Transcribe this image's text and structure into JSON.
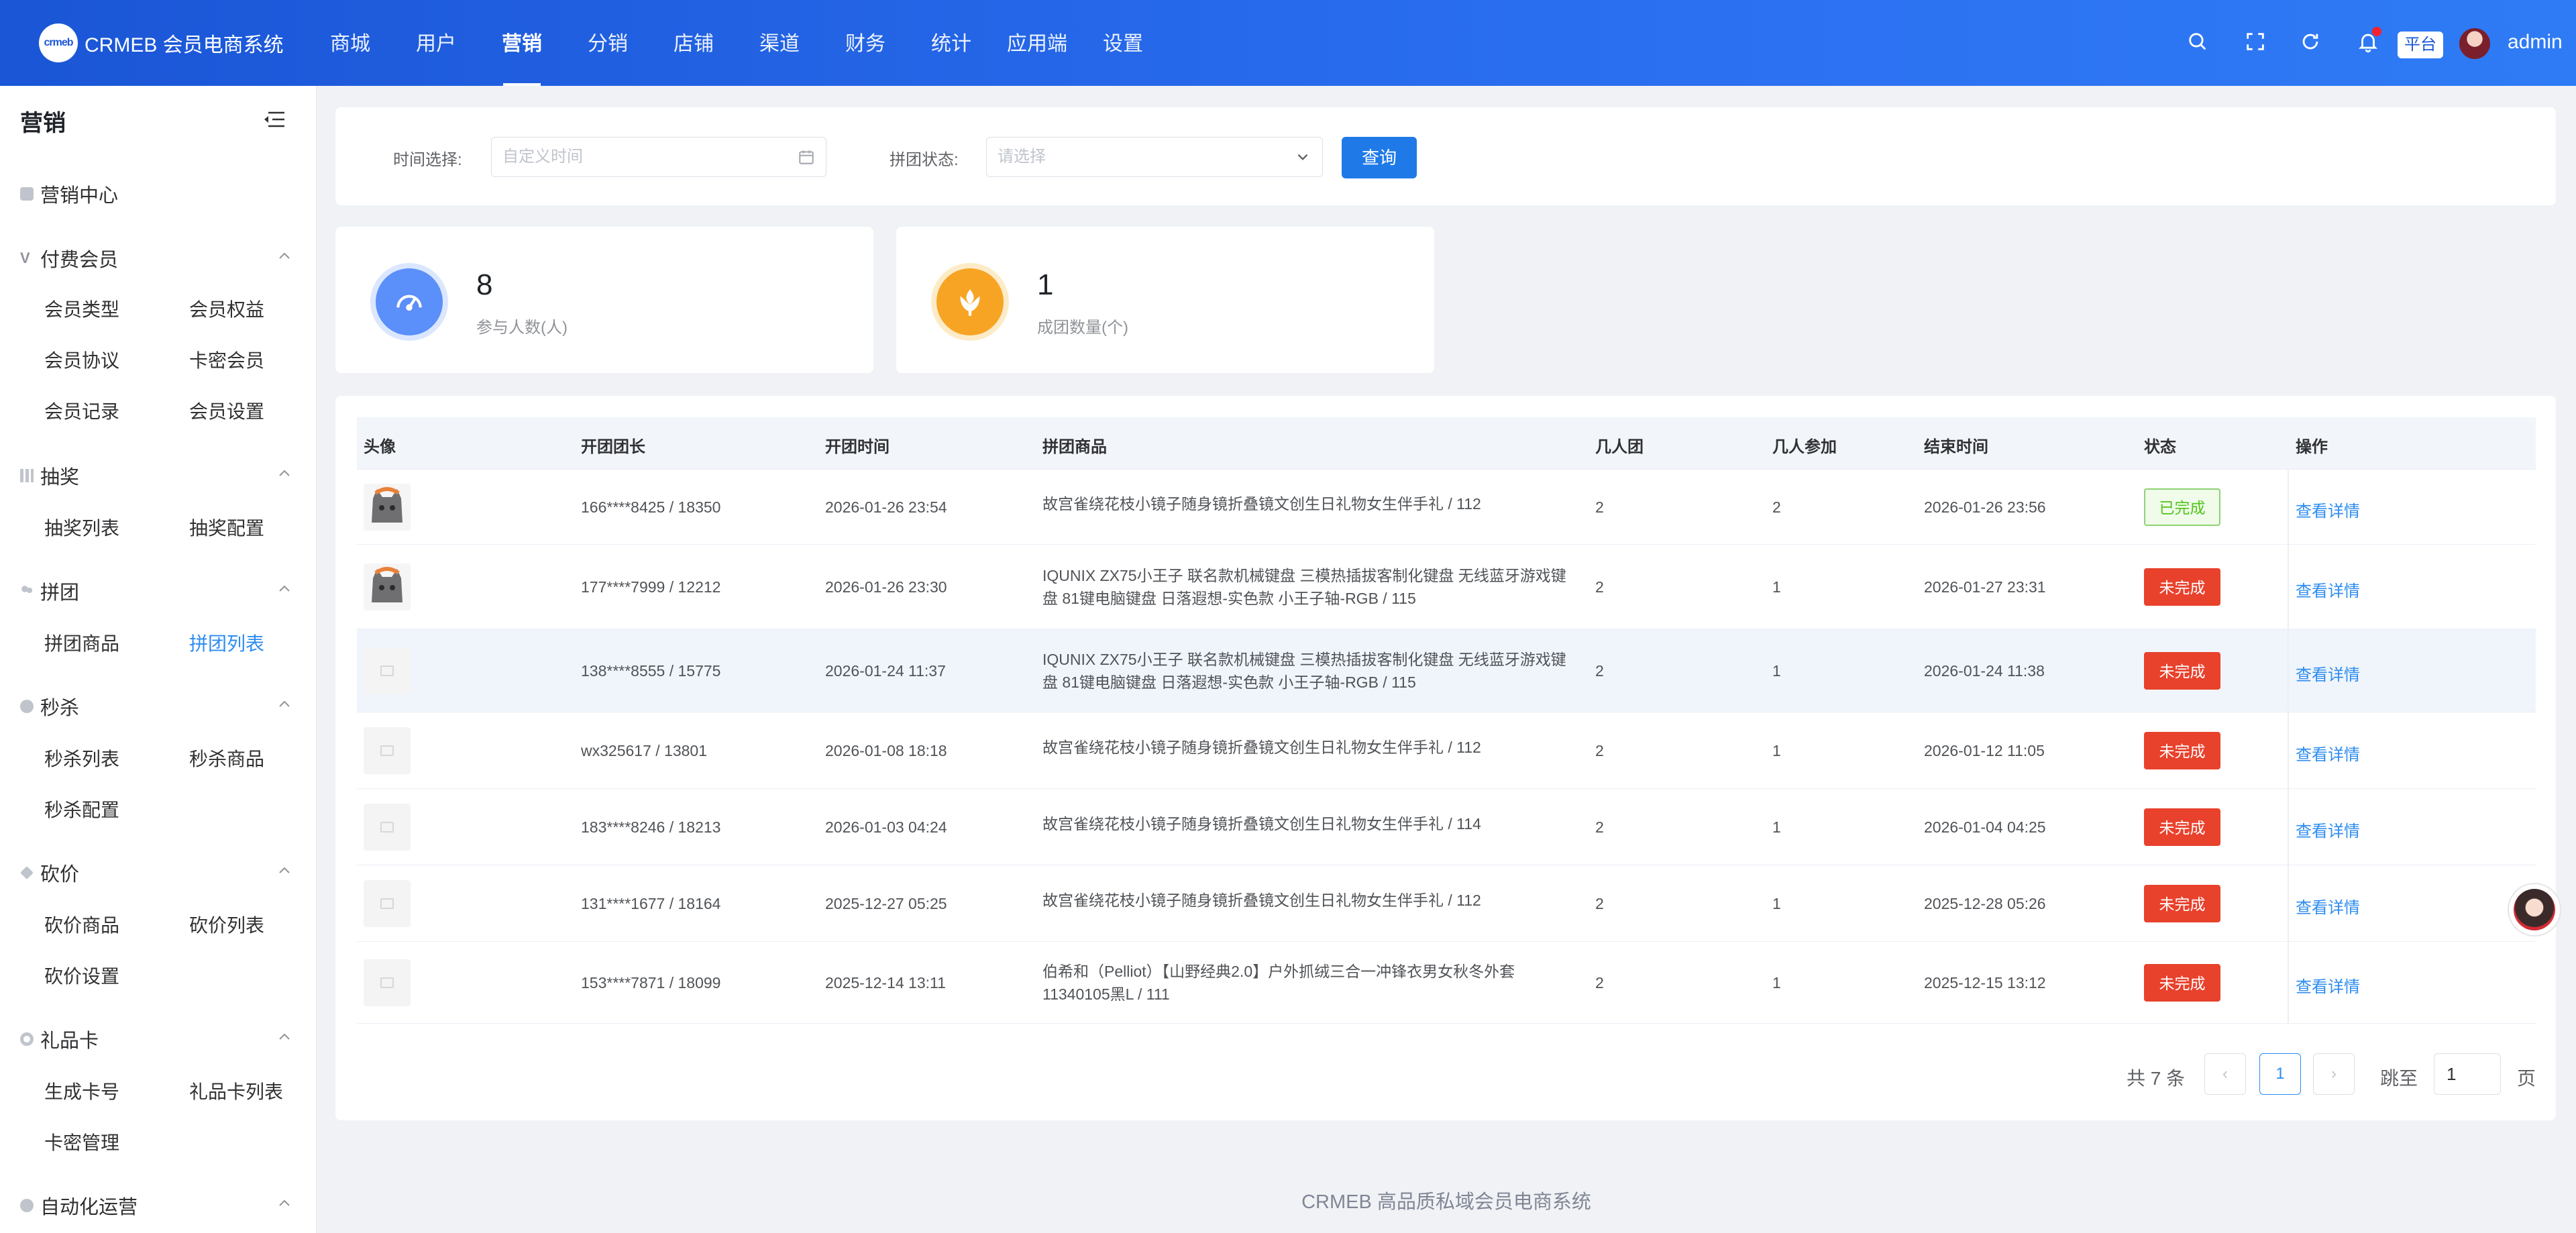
{
  "app": {
    "brand_mark": "crmeb",
    "title": "CRMEB 会员电商系统"
  },
  "topnav": [
    "商城",
    "用户",
    "营销",
    "分销",
    "店铺",
    "渠道",
    "财务",
    "统计",
    "应用端",
    "设置"
  ],
  "header": {
    "platform_tag": "平台",
    "username": "admin"
  },
  "sidebar": {
    "title": "营销",
    "center": "营销中心",
    "groups": [
      {
        "label": "付费会员",
        "items": [
          "会员类型",
          "会员权益",
          "会员协议",
          "卡密会员",
          "会员记录",
          "会员设置"
        ]
      },
      {
        "label": "抽奖",
        "items": [
          "抽奖列表",
          "抽奖配置"
        ]
      },
      {
        "label": "拼团",
        "items": [
          "拼团商品",
          "拼团列表"
        ]
      },
      {
        "label": "秒杀",
        "items": [
          "秒杀列表",
          "秒杀商品",
          "秒杀配置"
        ]
      },
      {
        "label": "砍价",
        "items": [
          "砍价商品",
          "砍价列表",
          "砍价设置"
        ]
      },
      {
        "label": "礼品卡",
        "items": [
          "生成卡号",
          "礼品卡列表",
          "卡密管理"
        ]
      },
      {
        "label": "自动化运营",
        "items": []
      }
    ],
    "active_item": "拼团列表"
  },
  "filters": {
    "time_label": "时间选择:",
    "time_placeholder": "自定义时间",
    "status_label": "拼团状态:",
    "status_placeholder": "请选择",
    "query_button": "查询"
  },
  "stats": [
    {
      "value": "8",
      "label": "参与人数(人)",
      "color": "#5b8ff9"
    },
    {
      "value": "1",
      "label": "成团数量(个)",
      "color": "#f7a425"
    }
  ],
  "table": {
    "columns": [
      "头像",
      "开团团长",
      "开团时间",
      "拼团商品",
      "几人团",
      "几人参加",
      "结束时间",
      "状态",
      "操作"
    ],
    "rows": [
      {
        "avatar": "cat",
        "leader": "166****8425 / 18350",
        "start": "2026-01-26 23:54",
        "product": "故宫雀绕花枝小镜子随身镜折叠镜文创生日礼物女生伴手礼 / 112",
        "group_size": "2",
        "joined": "2",
        "end": "2026-01-26 23:56",
        "status": "已完成",
        "done": true,
        "action": "查看详情"
      },
      {
        "avatar": "cat",
        "leader": "177****7999 / 12212",
        "start": "2026-01-26 23:30",
        "product": "IQUNIX ZX75小王子 联名款机械键盘 三模热插拔客制化键盘 无线蓝牙游戏键盘 81键电脑键盘 日落遐想-实色款 小王子轴-RGB / 115",
        "group_size": "2",
        "joined": "1",
        "end": "2026-01-27 23:31",
        "status": "未完成",
        "done": false,
        "action": "查看详情"
      },
      {
        "avatar": "placeholder",
        "leader": "138****8555 / 15775",
        "start": "2026-01-24 11:37",
        "product": "IQUNIX ZX75小王子 联名款机械键盘 三模热插拔客制化键盘 无线蓝牙游戏键盘 81键电脑键盘 日落遐想-实色款 小王子轴-RGB / 115",
        "group_size": "2",
        "joined": "1",
        "end": "2026-01-24 11:38",
        "status": "未完成",
        "done": false,
        "action": "查看详情"
      },
      {
        "avatar": "placeholder",
        "leader": "wx325617 / 13801",
        "start": "2026-01-08 18:18",
        "product": "故宫雀绕花枝小镜子随身镜折叠镜文创生日礼物女生伴手礼 / 112",
        "group_size": "2",
        "joined": "1",
        "end": "2026-01-12 11:05",
        "status": "未完成",
        "done": false,
        "action": "查看详情"
      },
      {
        "avatar": "placeholder",
        "leader": "183****8246 / 18213",
        "start": "2026-01-03 04:24",
        "product": "故宫雀绕花枝小镜子随身镜折叠镜文创生日礼物女生伴手礼 / 114",
        "group_size": "2",
        "joined": "1",
        "end": "2026-01-04 04:25",
        "status": "未完成",
        "done": false,
        "action": "查看详情"
      },
      {
        "avatar": "placeholder",
        "leader": "131****1677 / 18164",
        "start": "2025-12-27 05:25",
        "product": "故宫雀绕花枝小镜子随身镜折叠镜文创生日礼物女生伴手礼 / 112",
        "group_size": "2",
        "joined": "1",
        "end": "2025-12-28 05:26",
        "status": "未完成",
        "done": false,
        "action": "查看详情"
      },
      {
        "avatar": "placeholder",
        "leader": "153****7871 / 18099",
        "start": "2025-12-14 13:11",
        "product": "伯希和（Pelliot）【山野经典2.0】户外抓绒三合一冲锋衣男女秋冬外套11340105黑L / 111",
        "group_size": "2",
        "joined": "1",
        "end": "2025-12-15 13:12",
        "status": "未完成",
        "done": false,
        "action": "查看详情"
      }
    ]
  },
  "pagination": {
    "total": "共 7 条",
    "current": "1",
    "jump_label": "跳至",
    "jump_value": "1",
    "page_suffix": "页"
  },
  "footer": "CRMEB 高品质私域会员电商系统"
}
